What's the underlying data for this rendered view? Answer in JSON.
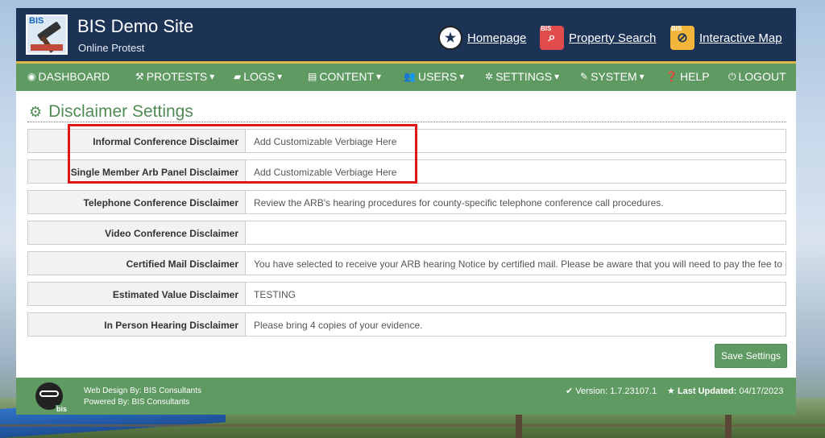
{
  "header": {
    "logo_text": "BIS",
    "site_title": "BIS Demo Site",
    "site_subtitle": "Online Protest",
    "links": [
      {
        "label": "Homepage",
        "icon": "star-badge-icon"
      },
      {
        "label": "Property Search",
        "icon": "magnifier-icon",
        "tag": "BIS"
      },
      {
        "label": "Interactive Map",
        "icon": "compass-icon",
        "tag": "BIS"
      }
    ]
  },
  "nav": [
    {
      "label": "DASHBOARD",
      "icon": "dashboard-icon"
    },
    {
      "label": "PROTESTS",
      "icon": "gavel-icon",
      "caret": true
    },
    {
      "label": "LOGS",
      "icon": "book-icon",
      "caret": true
    },
    {
      "label": "CONTENT",
      "icon": "file-icon",
      "caret": true
    },
    {
      "label": "USERS",
      "icon": "users-icon",
      "caret": true
    },
    {
      "label": "SETTINGS",
      "icon": "gear-icon",
      "caret": true
    },
    {
      "label": "SYSTEM",
      "icon": "wrench-icon",
      "caret": true
    },
    {
      "label": "HELP",
      "icon": "question-icon"
    },
    {
      "label": "LOGOUT",
      "icon": "power-icon"
    }
  ],
  "page": {
    "title": "Disclaimer Settings"
  },
  "settings": [
    {
      "label": "Informal Conference Disclaimer",
      "value": "Add Customizable Verbiage Here"
    },
    {
      "label": "Single Member Arb Panel Disclaimer",
      "value": "Add Customizable Verbiage Here"
    },
    {
      "label": "Telephone Conference Disclaimer",
      "value": "Review the ARB's hearing procedures for county-specific telephone conference call procedures."
    },
    {
      "label": "Video Conference Disclaimer",
      "value": ""
    },
    {
      "label": "Certified Mail Disclaimer",
      "value": "You have selected to receive your ARB hearing Notice by certified mail.  Please be aware that you will need to pay the fee to co"
    },
    {
      "label": "Estimated Value Disclaimer",
      "value": "TESTING"
    },
    {
      "label": "In Person Hearing Disclaimer",
      "value": "Please bring 4 copies of your evidence."
    }
  ],
  "save_label": "Save Settings",
  "footer": {
    "mascot_tag": "bis",
    "design_by": "Web Design By: BIS Consultants",
    "powered_by": "Powered By: BIS Consultants",
    "version_label": "Version: 1.7.23107.1",
    "updated_key": "Last Updated:",
    "updated_value": "04/17/2023"
  },
  "colors": {
    "header_bg": "#1c3356",
    "nav_bg": "#5f9a62",
    "accent_rule": "#e0b94a",
    "title_green": "#4f8b55",
    "highlight_red": "#e01616"
  }
}
